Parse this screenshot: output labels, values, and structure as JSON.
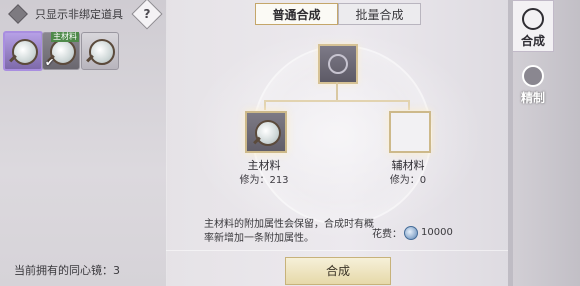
{
  "filter": {
    "label": "只显示非绑定道具",
    "help": "?"
  },
  "inventory": {
    "items": [
      {
        "icon": "mirror-icon",
        "selected": true,
        "tag": ""
      },
      {
        "icon": "mirror-icon",
        "selected": false,
        "tag": "主材料",
        "checked": true
      },
      {
        "icon": "mirror-icon",
        "selected": false,
        "tag": ""
      }
    ],
    "owned_text": "当前拥有的同心镜：3"
  },
  "tabs": [
    {
      "label": "普通合成",
      "active": true
    },
    {
      "label": "批量合成",
      "active": false
    }
  ],
  "side_tabs": [
    {
      "label": "合成",
      "icon": "swirl-icon",
      "active": true
    },
    {
      "label": "精制",
      "icon": "flame-icon",
      "active": false
    }
  ],
  "main_material": {
    "label": "主材料",
    "level": "修为：213"
  },
  "aux_material": {
    "label": "辅材料",
    "level": "修为：0"
  },
  "description": "主材料的附加属性会保留，合成时有概率新增加一条附加属性。",
  "cost": {
    "label": "花费：",
    "value": "10000",
    "icon": "silver-coin-icon"
  },
  "compose_button": "合成",
  "colors": {
    "accent_gold": "#c7b27a",
    "selected_purple": "#a98ee0"
  }
}
